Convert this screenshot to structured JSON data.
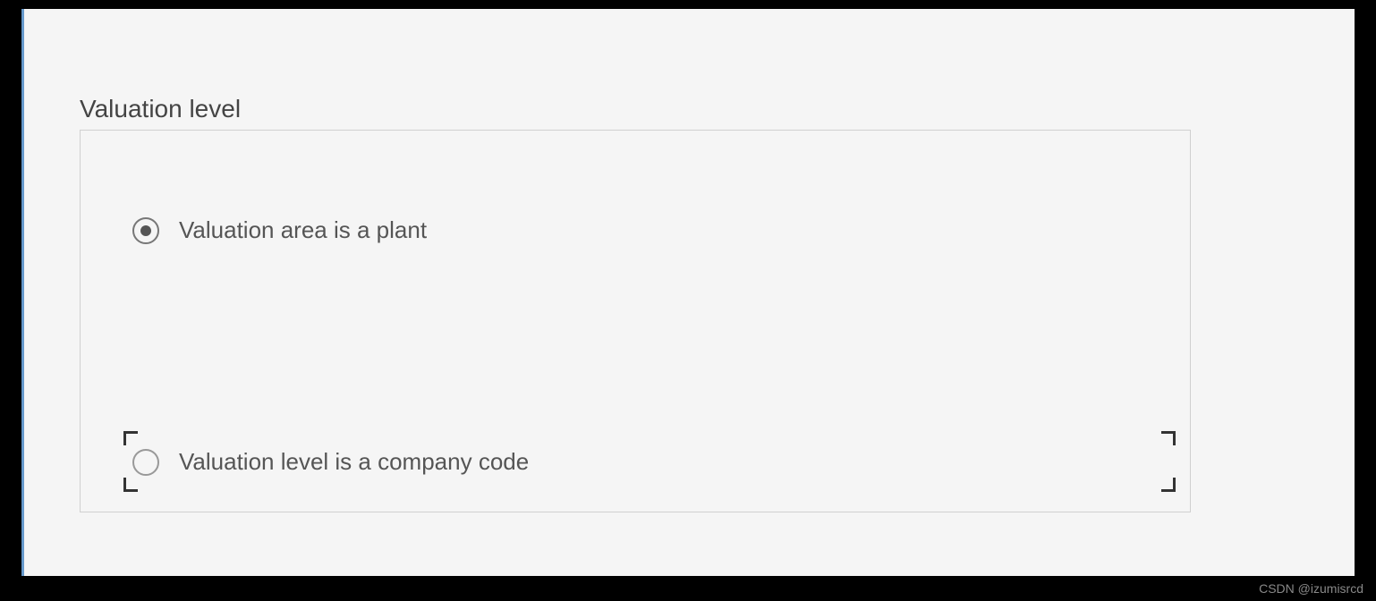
{
  "group": {
    "title": "Valuation level"
  },
  "options": {
    "plant": {
      "label": "Valuation area is a plant",
      "selected": true
    },
    "company_code": {
      "label": "Valuation level is a company code",
      "selected": false
    }
  },
  "watermark": "CSDN @izumisrcd"
}
